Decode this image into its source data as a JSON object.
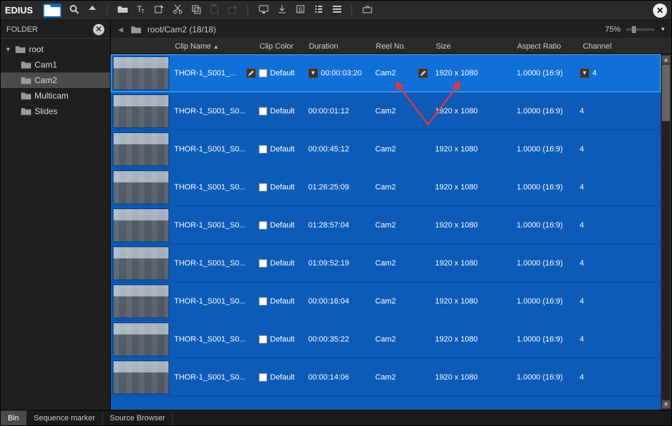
{
  "brand": "EDIUS",
  "sidebar": {
    "title": "FOLDER",
    "root": "root",
    "items": [
      "Cam1",
      "Cam2",
      "Multicam",
      "Slides"
    ],
    "selected": "Cam2"
  },
  "breadcrumb": "root/Cam2 (18/18)",
  "zoom_label": "75%",
  "columns": {
    "name": "Clip Name",
    "color": "Clip Color",
    "duration": "Duration",
    "reel": "Reel No.",
    "size": "Size",
    "aspect": "Aspect Ratio",
    "channel": "Channel"
  },
  "selected_row": 0,
  "clips": [
    {
      "name": "THOR-1_S001_...",
      "color": "Default",
      "duration": "00:00:03:20",
      "reel": "Cam2",
      "size": "1920 x 1080",
      "aspect": "1.0000 (16:9)",
      "channel": "4"
    },
    {
      "name": "THOR-1_S001_S0...",
      "color": "Default",
      "duration": "00:00:01:12",
      "reel": "Cam2",
      "size": "1920 x 1080",
      "aspect": "1.0000 (16:9)",
      "channel": "4"
    },
    {
      "name": "THOR-1_S001_S0...",
      "color": "Default",
      "duration": "00:00:45:12",
      "reel": "Cam2",
      "size": "1920 x 1080",
      "aspect": "1.0000 (16:9)",
      "channel": "4"
    },
    {
      "name": "THOR-1_S001_S0...",
      "color": "Default",
      "duration": "01:26:25:09",
      "reel": "Cam2",
      "size": "1920 x 1080",
      "aspect": "1.0000 (16:9)",
      "channel": "4"
    },
    {
      "name": "THOR-1_S001_S0...",
      "color": "Default",
      "duration": "01:28:57:04",
      "reel": "Cam2",
      "size": "1920 x 1080",
      "aspect": "1.0000 (16:9)",
      "channel": "4"
    },
    {
      "name": "THOR-1_S001_S0...",
      "color": "Default",
      "duration": "01:09:52:19",
      "reel": "Cam2",
      "size": "1920 x 1080",
      "aspect": "1.0000 (16:9)",
      "channel": "4"
    },
    {
      "name": "THOR-1_S001_S0...",
      "color": "Default",
      "duration": "00:00:16:04",
      "reel": "Cam2",
      "size": "1920 x 1080",
      "aspect": "1.0000 (16:9)",
      "channel": "4"
    },
    {
      "name": "THOR-1_S001_S0...",
      "color": "Default",
      "duration": "00:00:35:22",
      "reel": "Cam2",
      "size": "1920 x 1080",
      "aspect": "1.0000 (16:9)",
      "channel": "4"
    },
    {
      "name": "THOR-1_S001_S0...",
      "color": "Default",
      "duration": "00:00:14:06",
      "reel": "Cam2",
      "size": "1920 x 1080",
      "aspect": "1.0000 (16:9)",
      "channel": "4"
    }
  ],
  "tabs": [
    "Bin",
    "Sequence marker",
    "Source Browser"
  ],
  "active_tab": "Bin"
}
